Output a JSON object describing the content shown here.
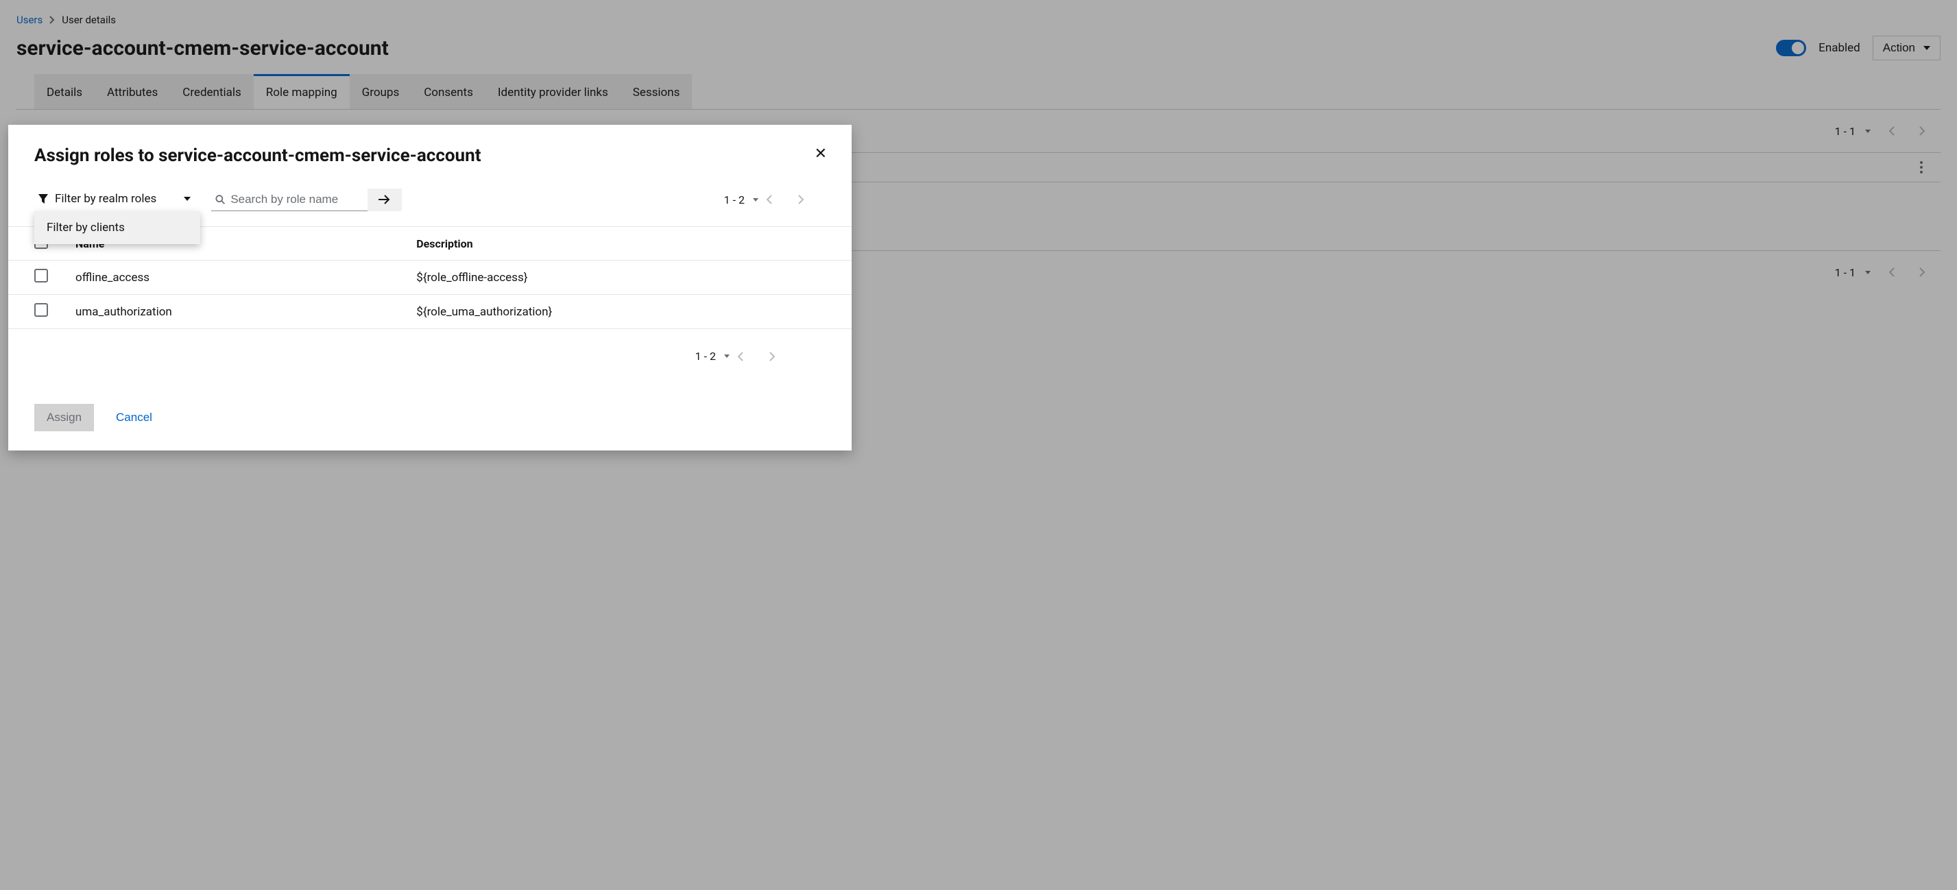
{
  "breadcrumbs": {
    "root": "Users",
    "current": "User details"
  },
  "page_title": "service-account-cmem-service-account",
  "header": {
    "enabled_label": "Enabled",
    "action_label": "Action"
  },
  "tabs": [
    {
      "label": "Details",
      "active": false
    },
    {
      "label": "Attributes",
      "active": false
    },
    {
      "label": "Credentials",
      "active": false
    },
    {
      "label": "Role mapping",
      "active": true
    },
    {
      "label": "Groups",
      "active": false
    },
    {
      "label": "Consents",
      "active": false
    },
    {
      "label": "Identity provider links",
      "active": false
    },
    {
      "label": "Sessions",
      "active": false
    }
  ],
  "bg_pagination": {
    "range": "1 - 1"
  },
  "modal": {
    "title": "Assign roles to service-account-cmem-service-account",
    "filter_label": "Filter by realm roles",
    "dropdown_option": "Filter by clients",
    "search_placeholder": "Search by role name",
    "pagination_range": "1 - 2",
    "columns": {
      "name": "Name",
      "description": "Description"
    },
    "rows": [
      {
        "name": "offline_access",
        "description": "${role_offline-access}"
      },
      {
        "name": "uma_authorization",
        "description": "${role_uma_authorization}"
      }
    ],
    "assign_label": "Assign",
    "cancel_label": "Cancel"
  }
}
